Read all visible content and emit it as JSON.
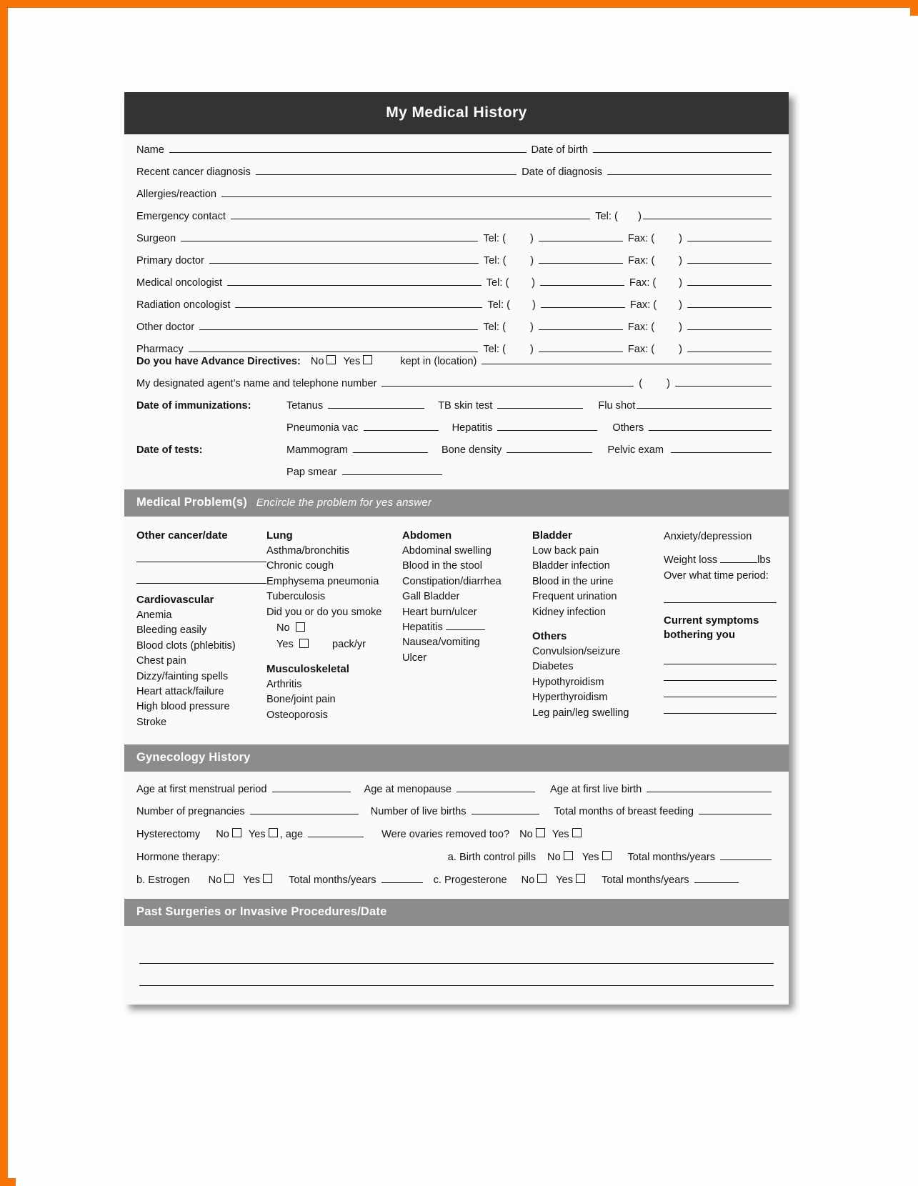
{
  "theme": {
    "border_color": "#f97406",
    "header_bg": "#333333",
    "band_bg": "#8c8c8c",
    "paper_bg": "#fafafa",
    "text_color": "#111111"
  },
  "header": {
    "title": "My Medical History"
  },
  "identity": {
    "name_label": "Name",
    "dob_label": "Date of birth",
    "cancer_dx_label": "Recent cancer diagnosis",
    "dx_date_label": "Date of diagnosis",
    "allergies_label": "Allergies/reaction",
    "emergency_label": "Emergency contact"
  },
  "labels": {
    "tel": "Tel: (",
    "fax": "Fax: (",
    "paren_close": ")",
    "paren_open": "("
  },
  "contacts": [
    {
      "label": "Surgeon"
    },
    {
      "label": "Primary doctor"
    },
    {
      "label": "Medical oncologist"
    },
    {
      "label": "Radiation oncologist"
    },
    {
      "label": "Other doctor"
    },
    {
      "label": "Pharmacy"
    }
  ],
  "directives": {
    "question": "Do you have Advance Directives:",
    "no": "No",
    "yes": "Yes",
    "kept_in": "kept in (location)",
    "agent_label": "My designated agent’s name and telephone number"
  },
  "immunizations": {
    "section_label": "Date of immunizations:",
    "row1": [
      {
        "label": "Tetanus"
      },
      {
        "label": "TB skin test"
      },
      {
        "label": "Flu shot"
      }
    ],
    "row2": [
      {
        "label": "Pneumonia vac"
      },
      {
        "label": "Hepatitis"
      },
      {
        "label": "Others"
      }
    ]
  },
  "tests": {
    "section_label": "Date of tests:",
    "row1": [
      {
        "label": "Mammogram"
      },
      {
        "label": "Bone density"
      },
      {
        "label": "Pelvic exam"
      }
    ],
    "row2": [
      {
        "label": "Pap smear"
      }
    ]
  },
  "medical_problems": {
    "band_title": "Medical Problem(s)",
    "band_subtitle": "Encircle the problem for yes answer",
    "columns": [
      {
        "groups": [
          {
            "head": "Other cancer/date",
            "blank_lines": 2,
            "items": []
          },
          {
            "head": "Cardiovascular",
            "items": [
              "Anemia",
              "Bleeding easily",
              "Blood clots (phlebitis)",
              "Chest pain",
              "Dizzy/fainting spells",
              "Heart attack/failure",
              "High blood pressure",
              "Stroke"
            ]
          }
        ]
      },
      {
        "groups": [
          {
            "head": "Lung",
            "items": [
              "Asthma/bronchitis",
              "Chronic cough",
              "Emphysema pneumonia",
              "Tuberculosis",
              "Did you or do you smoke"
            ],
            "smoke_options": {
              "no": "No",
              "yes": "Yes",
              "pack_label": "pack/yr"
            }
          },
          {
            "head": "Musculoskeletal",
            "items": [
              "Arthritis",
              "Bone/joint pain",
              "Osteoporosis"
            ]
          }
        ]
      },
      {
        "groups": [
          {
            "head": "Abdomen",
            "items": [
              "Abdominal swelling",
              "Blood in the stool",
              "Constipation/diarrhea",
              "Gall Bladder",
              "Heart burn/ulcer",
              "Hepatitis",
              "Nausea/vomiting",
              "Ulcer"
            ],
            "ruled_item": "Hepatitis"
          }
        ]
      },
      {
        "groups": [
          {
            "head": "Bladder",
            "items": [
              "Low back pain",
              "Bladder infection",
              "Blood in the urine",
              "Frequent urination",
              "Kidney infection"
            ]
          },
          {
            "head": "Others",
            "items": [
              "Convulsion/seizure",
              "Diabetes",
              "Hypothyroidism",
              "Hyperthyroidism",
              "Leg pain/leg swelling"
            ]
          }
        ]
      },
      {
        "anxiety": "Anxiety/depression",
        "weight_loss_label": "Weight loss",
        "weight_loss_unit": "lbs",
        "time_period_label": "Over what time period:",
        "current_symptoms_l1": "Current symptoms",
        "current_symptoms_l2": "bothering you",
        "symptom_lines": 4
      }
    ]
  },
  "gynecology": {
    "band_title": "Gynecology History",
    "row1": [
      {
        "label": "Age at first menstrual period"
      },
      {
        "label": "Age at menopause"
      },
      {
        "label": "Age at first live birth"
      }
    ],
    "row2": [
      {
        "label": "Number of pregnancies"
      },
      {
        "label": "Number of live births"
      },
      {
        "label": "Total months of breast feeding"
      }
    ],
    "hysterectomy": {
      "label": "Hysterectomy",
      "no": "No",
      "yes": "Yes",
      "age_label": ", age"
    },
    "ovaries": {
      "label": "Were ovaries removed too?",
      "no": "No",
      "yes": "Yes"
    },
    "hormone_label": "Hormone therapy:",
    "hormone_items": [
      {
        "label": "a. Birth control pills",
        "no": "No",
        "yes": "Yes",
        "total_label": "Total months/years"
      },
      {
        "label": "b. Estrogen",
        "no": "No",
        "yes": "Yes",
        "total_label": "Total months/years"
      },
      {
        "label": "c. Progesterone",
        "no": "No",
        "yes": "Yes",
        "total_label": "Total months/years"
      }
    ]
  },
  "surgeries": {
    "band_title": "Past Surgeries or Invasive Procedures/Date",
    "blank_lines": 2
  }
}
